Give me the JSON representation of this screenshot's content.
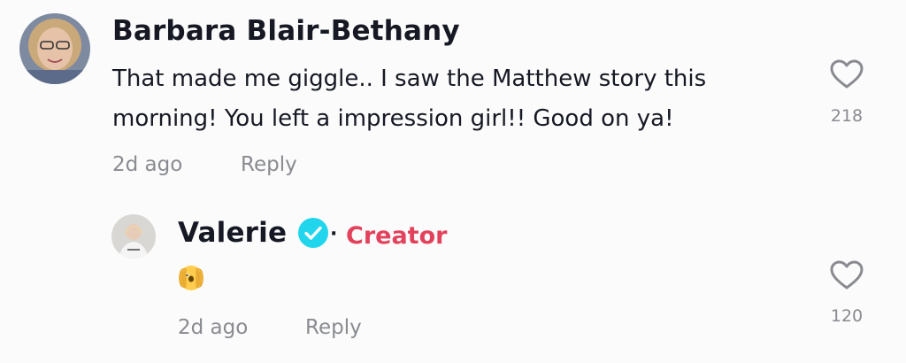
{
  "comment": {
    "author": "Barbara Blair-Bethany",
    "text": "That made me giggle.. I saw the Matthew story this morning! You left a impression girl!! Good on ya!",
    "time": "2d ago",
    "reply_label": "Reply",
    "likes": "218"
  },
  "reply": {
    "author": "Valerie",
    "separator": "·",
    "badge": "Creator",
    "emoji_name": "face-with-peeking-eye",
    "time": "2d ago",
    "reply_label": "Reply",
    "likes": "120"
  },
  "colors": {
    "background": "#fbfbfb",
    "text": "#161823",
    "muted": "#8a8b91",
    "creator": "#e3425c",
    "verified": "#20d5ec"
  }
}
